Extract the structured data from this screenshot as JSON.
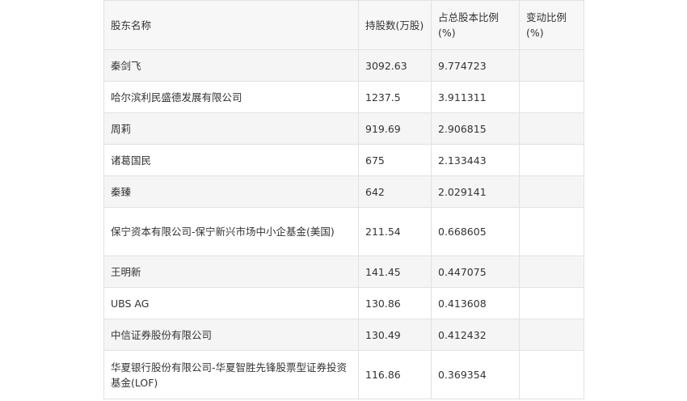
{
  "table": {
    "headers": [
      "股东名称",
      "持股数(万股)",
      "占总股本比例(%)",
      "变动比例(%)"
    ],
    "rows": [
      {
        "name": "秦剑飞",
        "shares": "3092.63",
        "ratio": "9.774723",
        "change": ""
      },
      {
        "name": "哈尔滨利民盛德发展有限公司",
        "shares": "1237.5",
        "ratio": "3.911311",
        "change": ""
      },
      {
        "name": "周莉",
        "shares": "919.69",
        "ratio": "2.906815",
        "change": ""
      },
      {
        "name": "诸葛国民",
        "shares": "675",
        "ratio": "2.133443",
        "change": ""
      },
      {
        "name": "秦臻",
        "shares": "642",
        "ratio": "2.029141",
        "change": ""
      },
      {
        "name": "保宁资本有限公司-保宁新兴市场中小企基金(美国)",
        "shares": "211.54",
        "ratio": "0.668605",
        "change": ""
      },
      {
        "name": "王明新",
        "shares": "141.45",
        "ratio": "0.447075",
        "change": ""
      },
      {
        "name": "UBS AG",
        "shares": "130.86",
        "ratio": "0.413608",
        "change": ""
      },
      {
        "name": "中信证券股份有限公司",
        "shares": "130.49",
        "ratio": "0.412432",
        "change": ""
      },
      {
        "name": "华夏银行股份有限公司-华夏智胜先锋股票型证券投资基金(LOF)",
        "shares": "116.86",
        "ratio": "0.369354",
        "change": ""
      }
    ]
  }
}
